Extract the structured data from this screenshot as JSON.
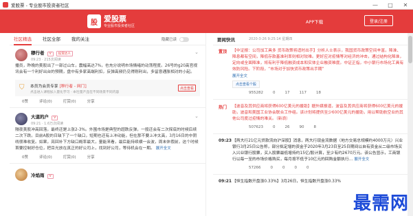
{
  "window": {
    "title": "爱股票 - 专业股市投资者社区",
    "minimize": "—",
    "maximize": "□",
    "close": "✕"
  },
  "header": {
    "logo_mark": "股",
    "brand": "爱股票",
    "slogan": "专业股市投资者社区",
    "app_download": "APP下载",
    "login": "登录/注册"
  },
  "left": {
    "tabs": [
      {
        "label": "社区精选"
      },
      {
        "label": "社区全部"
      },
      {
        "label": "我的关注"
      }
    ],
    "hide_read_label": "隐藏已读",
    "posts": [
      {
        "author": "穆行者",
        "badge1": "V",
        "badge2": "投资达人",
        "meta": "09:23 · 215次阅读",
        "body": "播员，昨晚的美股出了一部过山车，震幅高达7%，也充分说明市场情绪的动荡程度。26号的g20高官视讯会有一个利好出台的预期，盘中有多家高端利扣，反弹高频仍见得刚利出，多留意通胀相对的小起。",
        "card_title": "本员为会员专享",
        "card_highlight": "[穆行者 - 网门]",
        "card_sub": "点击进入课程加入量化学习 · 本社量产品在不同场景不同内容",
        "card_button": "点击查看",
        "actions": {
          "like": "0赞",
          "comment": "评论(0)",
          "reward": "打赏(0)",
          "share": "分享"
        }
      },
      {
        "author": "大道的户",
        "badge1": "V",
        "badge2": "",
        "meta": "09:21 · 1.6万次阅读",
        "body": "隔夜美股冲高回落，最终还是上涨2-3%。外围市场是典型的超跌反弹，一般还会有二次探底的时候后续二次下跌。目前A股的日缺下了一个缺口，短期也还有上冲动能，但在那不要上冲太高，3月16日的中阴线很难收复。如果，亮回补下方缺口概率最大，量能来看，最后能持续横一会波，周末休假前，这个时候首要控制好仓位，把目光放在真正的好公司上，找到好公司，等待机会在一期。",
        "expand": "展开全文",
        "actions": {
          "like": "0赞",
          "comment": "评论(0)",
          "reward": "打赏(0)",
          "share": "分享"
        }
      },
      {
        "author": "冷焰雨",
        "badge1": "V",
        "badge2": "",
        "meta": "",
        "body": "",
        "actions": {}
      }
    ]
  },
  "right": {
    "title": "要闻快讯",
    "date": "2020-3-26 9:25:14 星期四",
    "more": "展开全文",
    "news": [
      {
        "time": "置顶",
        "text": "【中证报：公司加工具多 货币政策将适时出手】分析人士表示，我国货币政策空间丰富，降准、降息都有空间，降低存款基准利率则相对较难。更好应对疫情等对经济的冲击，通过结构化降准，定向或全面降准，将有利于降低融资成本和实体企业融资难度。中证正指，中小银行市场化工具有效防风险。下阶段，“市场对于加快货币政策出手期”",
        "concept": "点击查看个股",
        "actions": {
          "views": "955282",
          "thumb": "0",
          "like": "17",
          "comment": "117",
          "share": "18"
        }
      },
      {
        "time": "热门",
        "text": "【波音及其供应商将获得600亿美元的援助】据外媒报道，波音及其供应商将获得600亿美元的援助，波音和美国工业协会联合工作组。该计划将提供至少600亿美元的援助，用以帮助航空业的其他公司度过疫情的难关。（新浪）",
        "concept": "",
        "actions": {
          "views": "507623",
          "thumb": "0",
          "like": "26",
          "comment": "90",
          "share": "8"
        }
      },
      {
        "time": "09:23",
        "text": "【两大行21亿元贷款流向沪深股】消息，两大行现金流数据（地方交易总规模约4000万元）兴业银行3月25日公告称，部分拟定增的资金于2020年3月23日至25日期间以自有资金从二级市场买入兴业银行股票，买入股票最低增持约15亿/股计算，至少有约2670万元。该公告显示，工商银行以每一至的市场价格购买，每月按不低于10亿元的回购金额执行…",
        "expand": "展开全文",
        "actions": {
          "views": "57266",
          "thumb": "0",
          "like": "0",
          "comment": "0",
          "share": "0"
        }
      },
      {
        "time": "09:21",
        "text": "【恒生指数开盘涨0.33%】3月26日，恒生指数开盘涨0.33%",
        "concept": "",
        "actions": {}
      }
    ]
  },
  "watermark": "最需网"
}
